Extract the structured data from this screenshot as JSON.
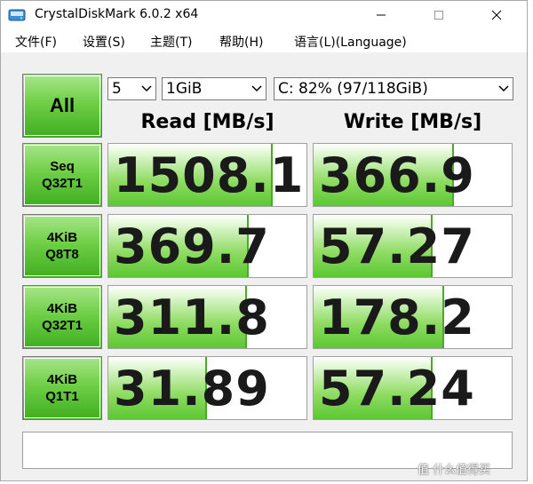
{
  "window": {
    "title": "CrystalDiskMark 6.0.2 x64",
    "accent_green": "#5cc732"
  },
  "menu": {
    "items": [
      {
        "label": "文件(F)"
      },
      {
        "label": "设置(S)"
      },
      {
        "label": "主题(T)"
      },
      {
        "label": "帮助(H)"
      },
      {
        "label": "语言(L)(Language)"
      }
    ]
  },
  "controls": {
    "all_label": "All",
    "test_count": "5",
    "test_size": "1GiB",
    "drive": "C: 82% (97/118GiB)"
  },
  "headers": {
    "read": "Read [MB/s]",
    "write": "Write [MB/s]"
  },
  "tests": [
    {
      "label": "Seq\nQ32T1",
      "read": "1508.1",
      "write": "366.9",
      "read_fill": 0.82,
      "write_fill": 0.7
    },
    {
      "label": "4KiB\nQ8T8",
      "read": "369.7",
      "write": "57.27",
      "read_fill": 0.7,
      "write_fill": 0.59
    },
    {
      "label": "4KiB\nQ32T1",
      "read": "311.8",
      "write": "178.2",
      "read_fill": 0.69,
      "write_fill": 0.65
    },
    {
      "label": "4KiB\nQ1T1",
      "read": "31.89",
      "write": "57.24",
      "read_fill": 0.49,
      "write_fill": 0.59
    }
  ],
  "watermark": "值 什么值得买"
}
